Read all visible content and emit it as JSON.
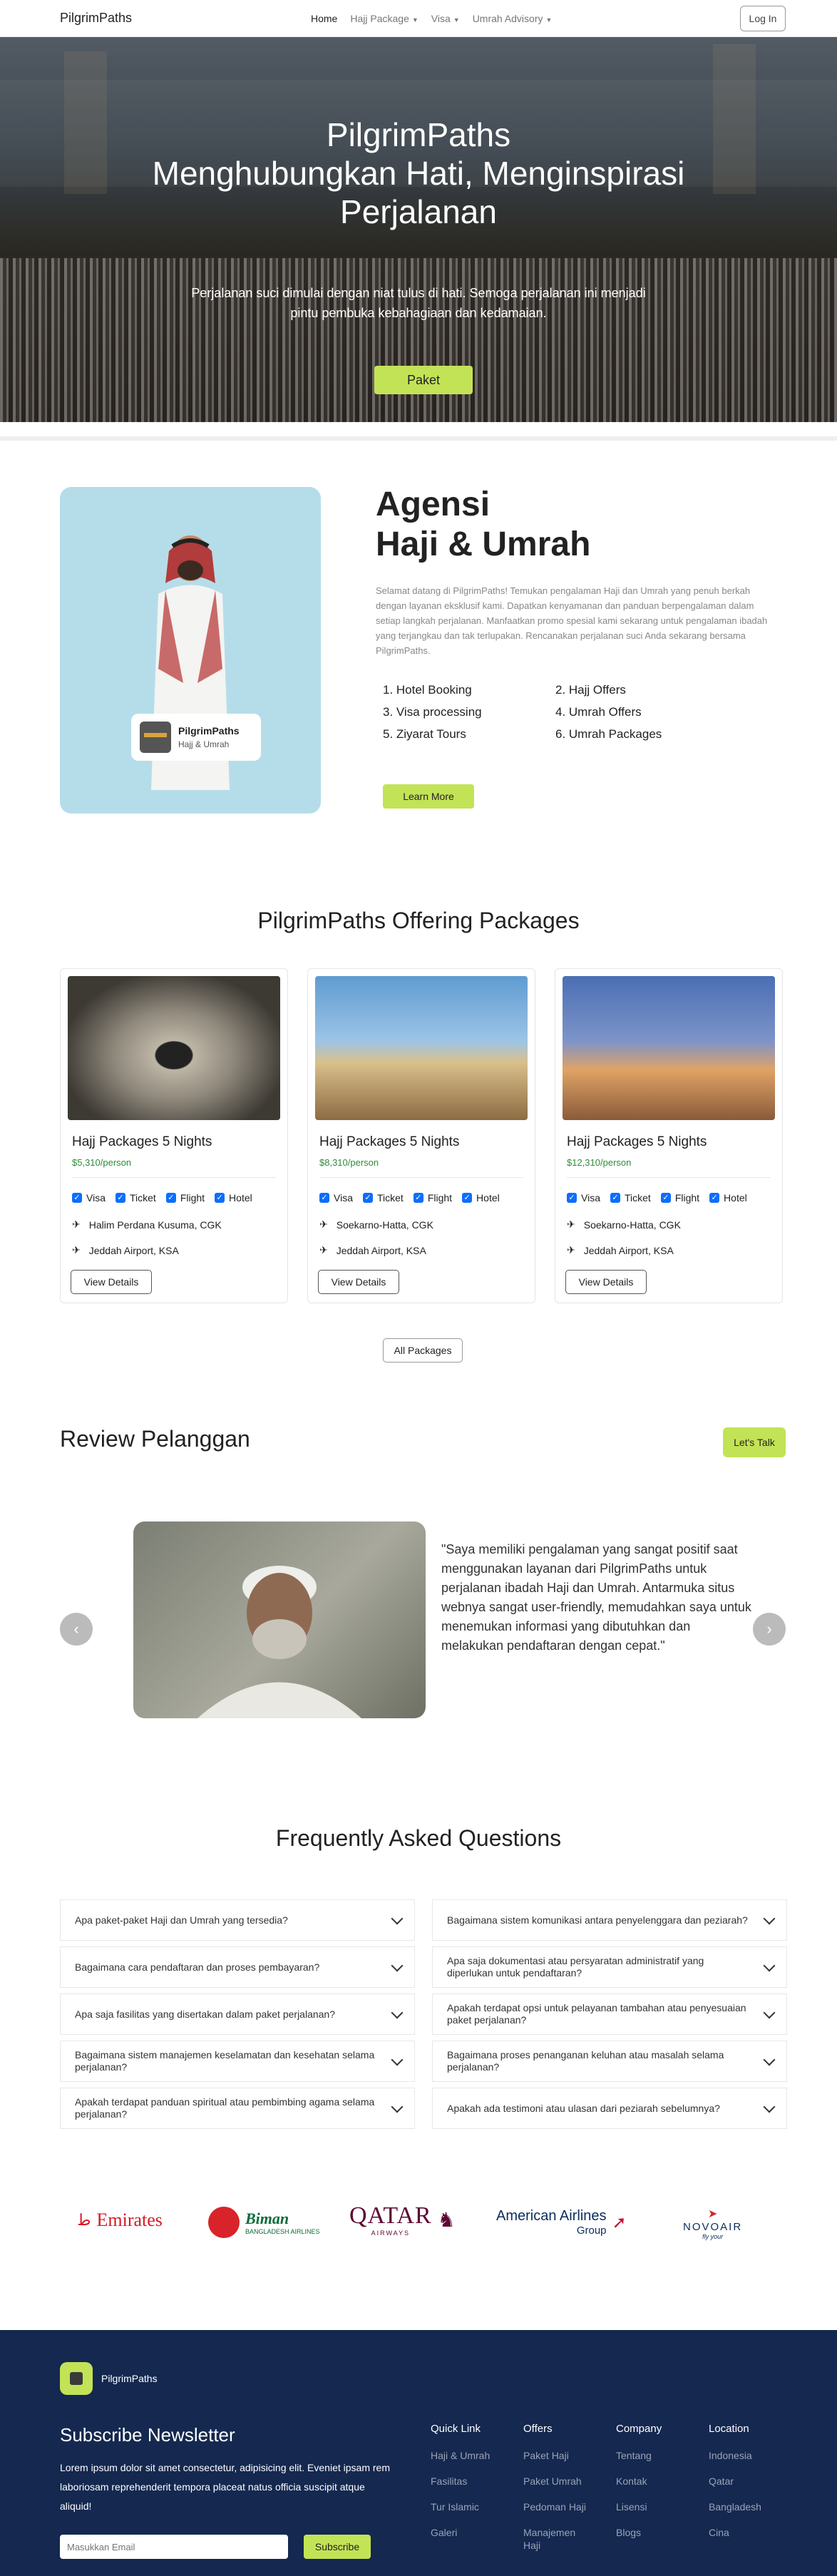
{
  "nav": {
    "brand": "PilgrimPaths",
    "items": [
      "Home",
      "Hajj Package",
      "Visa",
      "Umrah Advisory"
    ],
    "login": "Log In"
  },
  "hero": {
    "title1": "PilgrimPaths",
    "title2": "Menghubungkan Hati, Menginspirasi",
    "title3": "Perjalanan",
    "subtitle": "Perjalanan suci dimulai dengan niat tulus di hati. Semoga perjalanan ini menjadi pintu pembuka kebahagiaan dan kedamaian.",
    "button": "Paket"
  },
  "about": {
    "heading1": "Agensi",
    "heading2": "Haji & Umrah",
    "badge_title": "PilgrimPaths",
    "badge_sub": "Hajj & Umrah",
    "paragraph": "Selamat datang di PilgrimPaths! Temukan pengalaman Haji dan Umrah yang penuh berkah dengan layanan eksklusif kami. Dapatkan kenyamanan dan panduan berpengalaman dalam setiap langkah perjalanan. Manfaatkan promo spesial kami sekarang untuk pengalaman ibadah yang terjangkau dan tak terlupakan. Rencanakan perjalanan suci Anda sekarang bersama PilgrimPaths.",
    "list": [
      "1. Hotel Booking",
      "2. Hajj Offers",
      "3. Visa processing",
      "4. Umrah Offers",
      "5. Ziyarat Tours",
      "6. Umrah Packages"
    ],
    "learn_more": "Learn More"
  },
  "packages": {
    "title": "PilgrimPaths Offering Packages",
    "features": [
      "Visa",
      "Ticket",
      "Flight",
      "Hotel"
    ],
    "items": [
      {
        "name": "Hajj Packages 5 Nights",
        "price": "$5,310/person",
        "from": "Halim Perdana Kusuma, CGK",
        "to": "Jeddah Airport, KSA",
        "button": "View Details"
      },
      {
        "name": "Hajj Packages 5 Nights",
        "price": "$8,310/person",
        "from": "Soekarno-Hatta, CGK",
        "to": "Jeddah Airport, KSA",
        "button": "View Details"
      },
      {
        "name": "Hajj Packages 5 Nights",
        "price": "$12,310/person",
        "from": "Soekarno-Hatta, CGK",
        "to": "Jeddah Airport, KSA",
        "button": "View Details"
      }
    ],
    "all_button": "All Packages"
  },
  "review": {
    "title": "Review Pelanggan",
    "talk": "Let's Talk",
    "quote": "\"Saya memiliki pengalaman yang sangat positif saat menggunakan layanan dari PilgrimPaths untuk perjalanan ibadah Haji dan Umrah. Antarmuka situs webnya sangat user-friendly, memudahkan saya untuk menemukan informasi yang dibutuhkan dan melakukan pendaftaran dengan cepat.\""
  },
  "faq": {
    "title": "Frequently Asked Questions",
    "left": [
      "Apa paket-paket Haji dan Umrah yang tersedia?",
      "Bagaimana cara pendaftaran dan proses pembayaran?",
      "Apa saja fasilitas yang disertakan dalam paket perjalanan?",
      "Bagaimana sistem manajemen keselamatan dan kesehatan selama perjalanan?",
      "Apakah terdapat panduan spiritual atau pembimbing agama selama perjalanan?"
    ],
    "right": [
      "Bagaimana sistem komunikasi antara penyelenggara dan peziarah?",
      "Apa saja dokumentasi atau persyaratan administratif yang diperlukan untuk pendaftaran?",
      "Apakah terdapat opsi untuk pelayanan tambahan atau penyesuaian paket perjalanan?",
      "Bagaimana proses penanganan keluhan atau masalah selama perjalanan?",
      "Apakah ada testimoni atau ulasan dari peziarah sebelumnya?"
    ]
  },
  "partners": {
    "emirates": "Emirates",
    "biman": "Biman",
    "biman_sub": "BANGLADESH AIRLINES",
    "qatar": "QATAR",
    "qatar_sub": "AIRWAYS",
    "american": "American Airlines",
    "american_sub": "Group",
    "novoair": "NOVOAIR",
    "novoair_sub": "fly your"
  },
  "footer": {
    "brand": "PilgrimPaths",
    "heading": "Subscribe Newsletter",
    "text": "Lorem ipsum dolor sit amet consectetur, adipisicing elit. Eveniet ipsam rem laboriosam reprehenderit tempora placeat natus officia suscipit atque aliquid!",
    "placeholder": "Masukkan Email",
    "subscribe": "Subscribe",
    "columns": [
      {
        "title": "Quick Link",
        "items": [
          "Haji & Umrah",
          "Fasilitas",
          "Tur Islamic",
          "Galeri"
        ]
      },
      {
        "title": "Offers",
        "items": [
          "Paket Haji",
          "Paket Umrah",
          "Pedoman Haji",
          "Manajemen Haji"
        ]
      },
      {
        "title": "Company",
        "items": [
          "Tentang",
          "Kontak",
          "Lisensi",
          "Blogs"
        ]
      },
      {
        "title": "Location",
        "items": [
          "Indonesia",
          "Qatar",
          "Bangladesh",
          "Cina"
        ]
      }
    ]
  }
}
